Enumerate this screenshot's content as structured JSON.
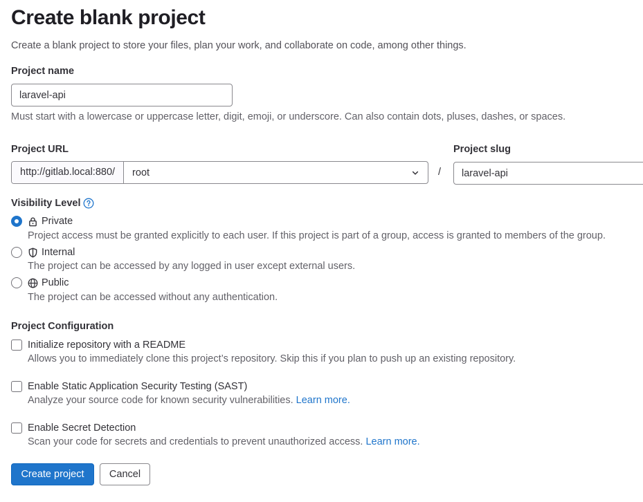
{
  "page": {
    "title": "Create blank project",
    "description": "Create a blank project to store your files, plan your work, and collaborate on code, among other things."
  },
  "project_name": {
    "label": "Project name",
    "value": "laravel-api",
    "help": "Must start with a lowercase or uppercase letter, digit, emoji, or underscore. Can also contain dots, pluses, dashes, or spaces."
  },
  "project_url": {
    "label": "Project URL",
    "prefix": "http://gitlab.local:880/",
    "namespace": "root",
    "separator": "/"
  },
  "project_slug": {
    "label": "Project slug",
    "value": "laravel-api"
  },
  "visibility": {
    "label": "Visibility Level",
    "selected": "private",
    "options": [
      {
        "label": "Private",
        "icon": "lock-icon",
        "help": "Project access must be granted explicitly to each user. If this project is part of a group, access is granted to members of the group."
      },
      {
        "label": "Internal",
        "icon": "shield-icon",
        "help": "The project can be accessed by any logged in user except external users."
      },
      {
        "label": "Public",
        "icon": "globe-icon",
        "help": "The project can be accessed without any authentication."
      }
    ]
  },
  "configuration": {
    "label": "Project Configuration",
    "options": [
      {
        "label": "Initialize repository with a README",
        "help": "Allows you to immediately clone this project’s repository. Skip this if you plan to push up an existing repository.",
        "link": ""
      },
      {
        "label": "Enable Static Application Security Testing (SAST)",
        "help": "Analyze your source code for known security vulnerabilities.",
        "link": "Learn more."
      },
      {
        "label": "Enable Secret Detection",
        "help": "Scan your code for secrets and credentials to prevent unauthorized access.",
        "link": "Learn more."
      }
    ]
  },
  "actions": {
    "create": "Create project",
    "cancel": "Cancel"
  },
  "colors": {
    "primary": "#1f75cb",
    "text": "#333238",
    "muted": "#626168"
  }
}
